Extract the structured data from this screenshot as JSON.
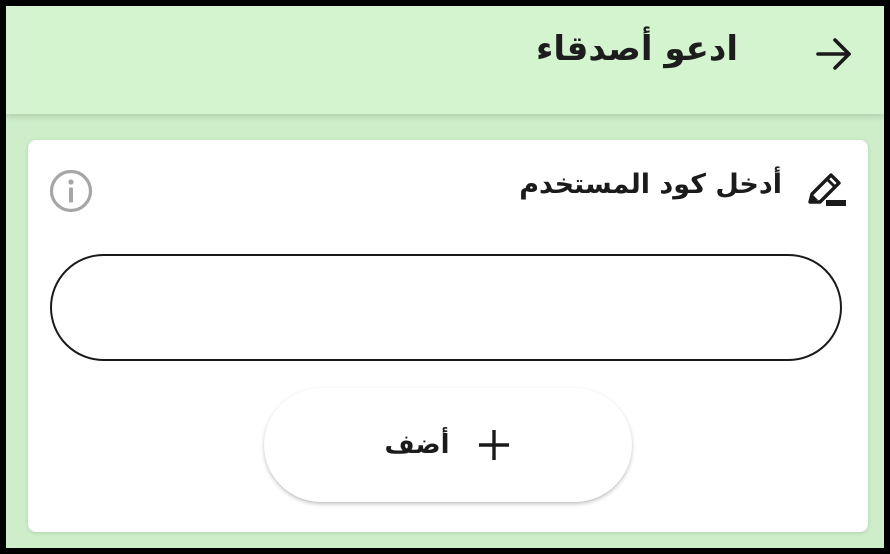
{
  "app_bar": {
    "title": "ادعو أصدقاء",
    "back_icon": "arrow-right-icon"
  },
  "card": {
    "title": "أدخل كود المستخدم",
    "title_icon": "edit-icon",
    "info_icon": "info-icon",
    "user_code_input": {
      "value": "",
      "placeholder": ""
    },
    "add_button": {
      "label": "أضف",
      "icon": "plus-icon"
    }
  },
  "colors": {
    "app_bar_background": "#d4f4d0",
    "page_background": "#cdeec9",
    "card_background": "#ffffff",
    "text": "#1b1b1b",
    "info_icon": "#a6a6a6"
  }
}
